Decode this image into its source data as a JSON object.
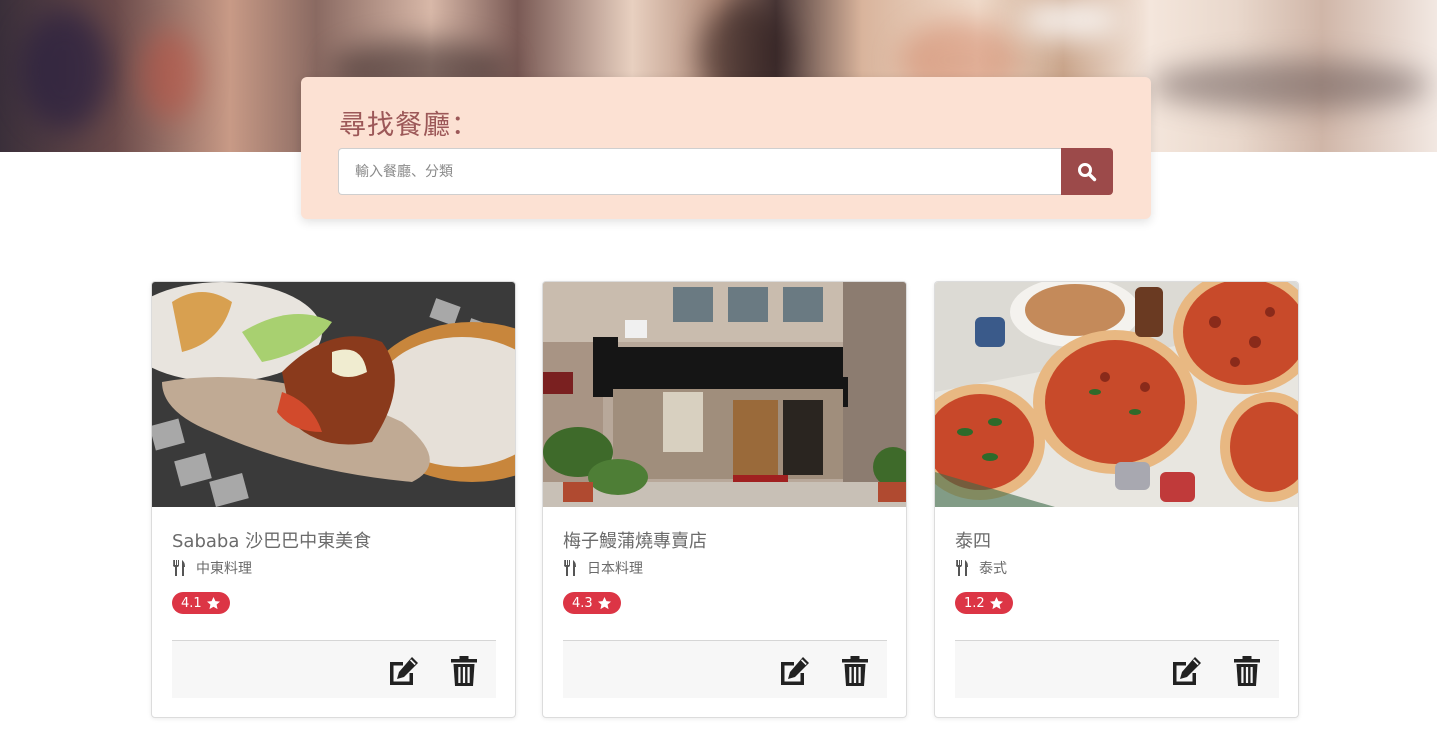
{
  "search": {
    "title": "尋找餐廳：",
    "placeholder": "輸入餐廳、分類",
    "button_icon": "search-icon"
  },
  "restaurants": [
    {
      "name": "Sababa 沙巴巴中東美食",
      "category": "中東料理",
      "rating": "4.1",
      "category_icon": "utensils-icon"
    },
    {
      "name": "梅子鰻蒲燒專賣店",
      "category": "日本料理",
      "rating": "4.3",
      "category_icon": "utensils-icon"
    },
    {
      "name": "泰四",
      "category": "泰式",
      "rating": "1.2",
      "category_icon": "utensils-icon"
    }
  ],
  "colors": {
    "search_panel": "#fce1d3",
    "search_button": "#9c4a4a",
    "rating_badge": "#dc3545"
  }
}
